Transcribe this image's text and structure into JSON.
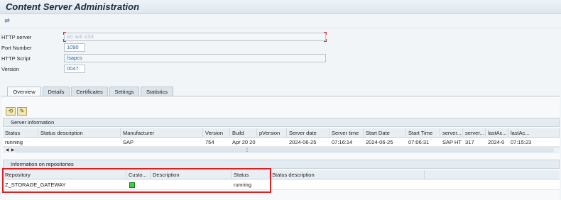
{
  "window": {
    "title": "Content Server Administration"
  },
  "toolbar": {
    "execute_icon": "execute-icon"
  },
  "form": {
    "http_server": {
      "label": "HTTP server",
      "value": "sti w4 s34"
    },
    "port_number": {
      "label": "Port Number",
      "value": "1090"
    },
    "http_script": {
      "label": "HTTP Script",
      "value": "/sapcs"
    },
    "version": {
      "label": "Version",
      "value": "0047"
    }
  },
  "tabs": [
    {
      "label": "Overview",
      "active": true
    },
    {
      "label": "Details",
      "active": false
    },
    {
      "label": "Certificates",
      "active": false
    },
    {
      "label": "Settings",
      "active": false
    },
    {
      "label": "Statistics",
      "active": false
    }
  ],
  "action_buttons": {
    "refresh_icon": "refresh-icon",
    "edit_icon": "edit-icon"
  },
  "server_info": {
    "title": "Server information",
    "columns": [
      "Status",
      "Status description",
      "Manufacturer",
      "Version",
      "Build",
      "pVersion",
      "Server date",
      "Server time",
      "Start Date",
      "Start Time",
      "server...",
      "server...",
      "lastAc...",
      "lastAc..."
    ],
    "rows": [
      [
        "running",
        "",
        "SAP",
        "754",
        "Apr 20 20",
        "",
        "2024-06-25",
        "07:16:14",
        "2024-06-25",
        "07:06:31",
        "SAP HT",
        "317",
        "2024-0",
        "07:15:23"
      ]
    ]
  },
  "repositories": {
    "title": "Information on repositories",
    "columns": [
      "Repository",
      "Custo...",
      "Description",
      "Status",
      "Status description"
    ],
    "rows": [
      {
        "repository": "Z_STORAGE_GATEWAY",
        "status_color": "#3fd13f",
        "description": "",
        "status": "running",
        "status_description": ""
      }
    ]
  },
  "colors": {
    "highlight": "#e02020",
    "link": "#1f5ea8"
  }
}
